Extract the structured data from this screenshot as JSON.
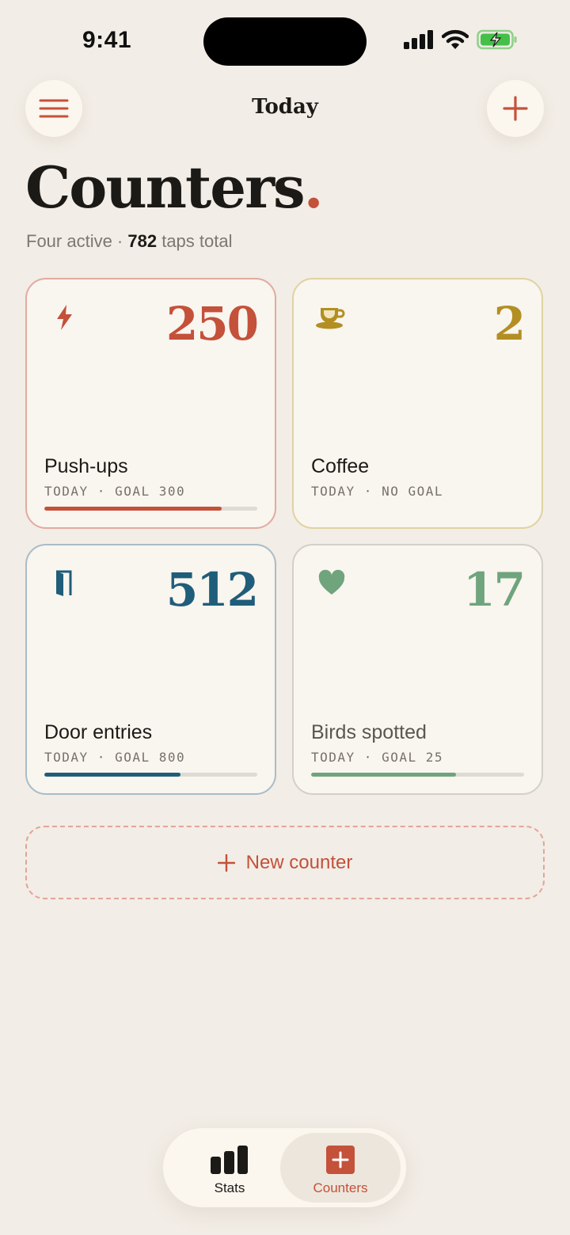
{
  "status_bar": {
    "time": "9:41"
  },
  "header": {
    "title": "Today"
  },
  "page": {
    "title": "Counters",
    "title_dot": ".",
    "subtitle_prefix": "Four active · ",
    "subtitle_count": "782",
    "subtitle_suffix": " taps total"
  },
  "colors": {
    "accent": "#c4513a",
    "pushups": "#c4513a",
    "coffee": "#b38f22",
    "door": "#1f5d7a",
    "birds": "#6fa47c"
  },
  "counters": [
    {
      "name": "Push-ups",
      "value": "250",
      "meta": "TODAY · GOAL 300",
      "progress": 0.833,
      "icon": "bolt-icon"
    },
    {
      "name": "Coffee",
      "value": "2",
      "meta": "TODAY · NO GOAL",
      "progress": null,
      "icon": "coffee-cup-icon"
    },
    {
      "name": "Door entries",
      "value": "512",
      "meta": "TODAY · GOAL 800",
      "progress": 0.64,
      "icon": "door-icon"
    },
    {
      "name": "Birds spotted",
      "value": "17",
      "meta": "TODAY · GOAL 25",
      "progress": 0.68,
      "icon": "heart-icon"
    }
  ],
  "new_counter": {
    "label": "New counter"
  },
  "tabbar": {
    "tabs": [
      {
        "label": "Stats",
        "icon": "bar-chart-icon",
        "active": false
      },
      {
        "label": "Counters",
        "icon": "plus-square-icon",
        "active": true
      }
    ]
  }
}
